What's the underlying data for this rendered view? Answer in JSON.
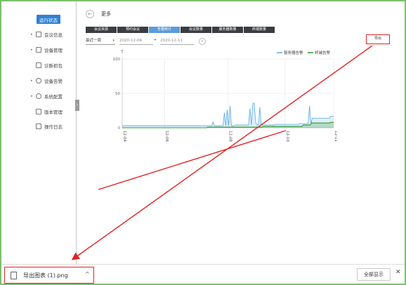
{
  "sidebar": {
    "items": [
      {
        "label": "运行状态",
        "active": true
      },
      {
        "label": "会议信息",
        "caret": true
      },
      {
        "label": "设备管理",
        "caret": true
      },
      {
        "label": "诊断抓包",
        "caret": false
      },
      {
        "label": "设备告警",
        "caret": true
      },
      {
        "label": "系统配置",
        "caret": true
      },
      {
        "label": "版本管理",
        "caret": false
      },
      {
        "label": "操作日志",
        "caret": false
      }
    ],
    "collapse_glyph": "‹"
  },
  "header": {
    "back_glyph": "←",
    "title": "更多"
  },
  "tabs": [
    {
      "label": "会议资源"
    },
    {
      "label": "预约会议"
    },
    {
      "label": "告警统计",
      "active": true
    },
    {
      "label": "会议数量"
    },
    {
      "label": "服务器数量"
    },
    {
      "label": "终端数量"
    }
  ],
  "filters": {
    "range_value": "最近一周",
    "range_glyph": "▾",
    "date_start": "2020-12-04",
    "date_sep": "→",
    "date_end": "2020-12-11",
    "search_icon": "search-icon",
    "export_label": "导出"
  },
  "chart_data": {
    "type": "area",
    "legend_position": "top-right",
    "y_ticks": [
      0,
      50,
      100
    ],
    "ylim": [
      0,
      100
    ],
    "x_tick_labels": [
      "12-04",
      "12-06",
      "12-08",
      "12-10",
      "12-11"
    ],
    "y_axis_glyph": "↑",
    "series": [
      {
        "name": "服务器告警",
        "color": "#5aa9e6",
        "values": [
          3,
          3,
          3,
          3,
          3,
          3,
          3,
          3,
          3,
          3,
          3,
          3,
          3,
          3,
          3,
          3,
          3,
          3,
          3,
          3,
          3,
          3,
          3,
          3,
          3,
          3,
          3,
          3,
          3,
          3,
          3,
          3,
          3,
          3,
          3,
          3,
          3,
          3,
          3,
          3,
          3,
          3,
          3,
          3,
          3,
          3,
          3,
          3,
          3,
          3,
          3,
          3,
          3,
          3,
          3,
          3,
          3,
          3,
          3,
          3,
          3,
          3,
          3,
          3,
          8,
          3,
          3,
          3,
          3,
          3,
          3,
          3,
          22,
          3,
          26,
          3,
          32,
          3,
          3,
          3,
          4,
          4,
          4,
          4,
          4,
          4,
          4,
          4,
          4,
          4,
          28,
          4,
          35,
          36,
          8,
          4,
          4,
          30,
          4,
          4,
          4,
          4,
          4,
          4,
          4,
          4,
          4,
          4,
          5,
          5,
          5,
          5,
          5,
          5,
          5,
          5,
          5,
          5,
          5,
          5,
          5,
          5,
          5,
          5,
          5,
          6,
          6,
          6,
          6,
          6,
          6,
          6,
          32,
          6,
          14,
          14,
          14,
          14,
          14,
          14,
          14,
          14,
          14,
          14,
          14,
          14,
          14,
          17,
          17,
          17
        ]
      },
      {
        "name": "终端告警",
        "color": "#2e9b2e",
        "values": [
          0,
          0,
          0,
          0,
          0,
          0,
          0,
          0,
          0,
          0,
          0,
          0,
          0,
          0,
          0,
          0,
          0,
          0,
          0,
          0,
          0,
          0,
          0,
          0,
          0,
          0,
          0,
          0,
          0,
          0,
          0,
          0,
          0,
          0,
          0,
          0,
          0,
          0,
          0,
          0,
          0,
          0,
          0,
          0,
          0,
          0,
          0,
          0,
          0,
          0,
          0,
          0,
          0,
          0,
          0,
          0,
          0,
          0,
          0,
          0,
          0,
          0,
          1,
          1,
          1,
          1,
          1,
          1,
          1,
          1,
          1,
          1,
          1,
          1,
          1,
          1,
          1,
          1,
          1,
          1,
          1,
          1,
          1,
          1,
          1,
          1,
          1,
          1,
          1,
          1,
          1,
          1,
          1,
          1,
          1,
          1,
          1,
          1,
          1,
          1,
          1,
          1,
          2,
          2,
          2,
          2,
          2,
          2,
          2,
          2,
          2,
          2,
          2,
          2,
          2,
          2,
          2,
          2,
          2,
          2,
          2,
          2,
          2,
          2,
          2,
          2,
          2,
          2,
          2,
          2,
          2,
          4,
          4,
          4,
          4,
          4,
          4,
          7,
          7,
          7,
          7,
          7,
          7,
          7,
          7,
          7,
          7,
          7,
          7,
          7,
          7,
          8,
          8,
          8
        ]
      }
    ]
  },
  "download_bar": {
    "file_name": "导出图表 (1).png",
    "caret_glyph": "^",
    "show_all_label": "全部显示",
    "close_glyph": "✕"
  },
  "colors": {
    "sidebar_active": "#2f7fd6",
    "tab_bg": "#3a3d42",
    "tab_active": "#5a9bd8",
    "annotation_red": "#e02424",
    "frame_green": "#7bc06b"
  }
}
